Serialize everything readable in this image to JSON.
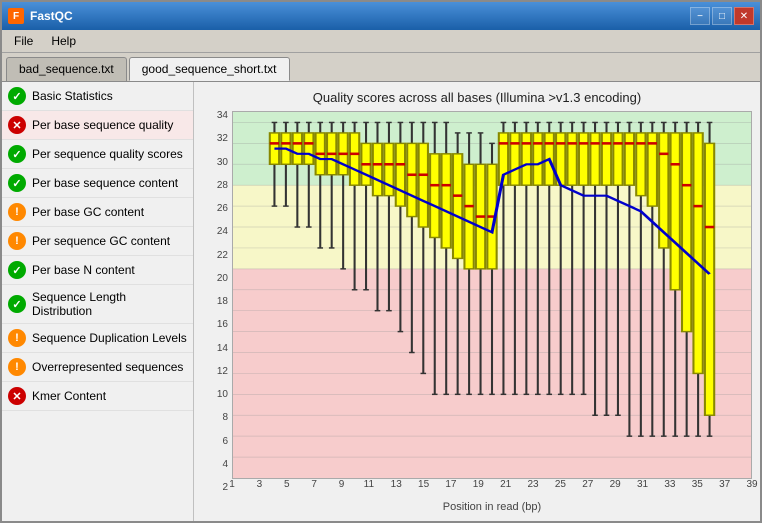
{
  "app": {
    "title": "FastQC",
    "icon": "F"
  },
  "titlebar": {
    "minimize_label": "−",
    "maximize_label": "□",
    "close_label": "✕"
  },
  "menubar": {
    "items": [
      {
        "label": "File",
        "id": "file"
      },
      {
        "label": "Help",
        "id": "help"
      }
    ]
  },
  "tabs": [
    {
      "label": "bad_sequence.txt",
      "active": false
    },
    {
      "label": "good_sequence_short.txt",
      "active": true
    }
  ],
  "sidebar": {
    "items": [
      {
        "id": "basic-stats",
        "label": "Basic Statistics",
        "status": "ok"
      },
      {
        "id": "per-base-seq-quality",
        "label": "Per base sequence quality",
        "status": "fail"
      },
      {
        "id": "per-seq-quality",
        "label": "Per sequence quality scores",
        "status": "ok"
      },
      {
        "id": "per-base-seq-content",
        "label": "Per base sequence content",
        "status": "ok"
      },
      {
        "id": "per-base-gc",
        "label": "Per base GC content",
        "status": "warn"
      },
      {
        "id": "per-seq-gc",
        "label": "Per sequence GC content",
        "status": "warn"
      },
      {
        "id": "per-base-n",
        "label": "Per base N content",
        "status": "ok"
      },
      {
        "id": "seq-length-dist",
        "label": "Sequence Length Distribution",
        "status": "ok"
      },
      {
        "id": "seq-dup-levels",
        "label": "Sequence Duplication Levels",
        "status": "warn"
      },
      {
        "id": "overrep-seq",
        "label": "Overrepresented sequences",
        "status": "warn"
      },
      {
        "id": "kmer-content",
        "label": "Kmer Content",
        "status": "fail"
      }
    ]
  },
  "chart": {
    "title": "Quality scores across all bases (Illumina >v1.3 encoding)",
    "x_axis_title": "Position in read (bp)",
    "y_axis_labels": [
      "34",
      "32",
      "30",
      "28",
      "26",
      "24",
      "22",
      "20",
      "18",
      "16",
      "14",
      "12",
      "10",
      "8",
      "6",
      "4",
      "2"
    ],
    "x_axis_labels": [
      "1",
      "3",
      "5",
      "7",
      "9",
      "11",
      "13",
      "15",
      "17",
      "19",
      "21",
      "23",
      "25",
      "27",
      "29",
      "31",
      "33",
      "35",
      "37",
      "39"
    ],
    "colors": {
      "green_zone": "rgba(144,238,144,0.4)",
      "yellow_zone": "rgba(255,255,150,0.5)",
      "red_zone": "rgba(255,180,180,0.5)",
      "box_yellow": "#ffff00",
      "box_orange": "#ff8800",
      "whisker": "#000000",
      "median_line": "#ff0000",
      "mean_line": "#0000ff",
      "box_stroke": "#888800"
    }
  }
}
